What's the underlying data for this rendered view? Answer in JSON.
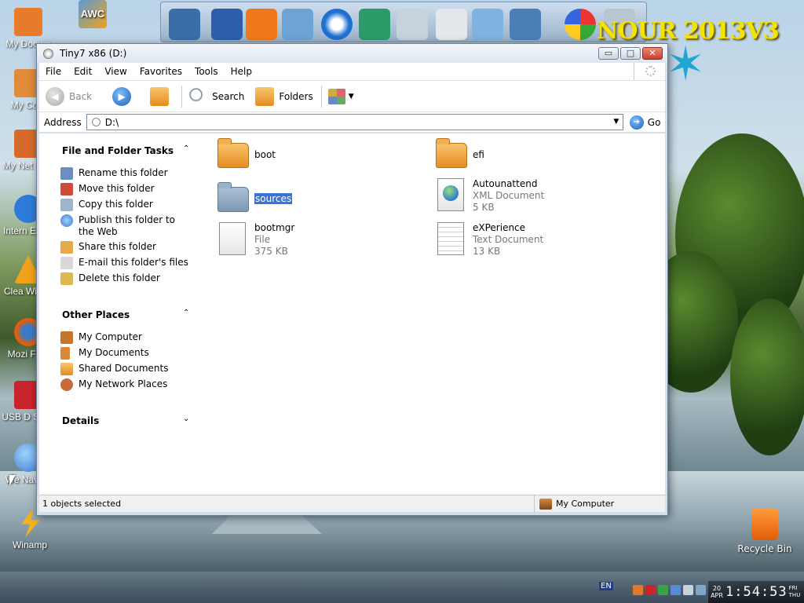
{
  "desktop": {
    "icons": [
      {
        "label": "My Docum",
        "color": "#e87a2b"
      },
      {
        "label": "My Com",
        "color": "#e08a3a"
      },
      {
        "label": "My Net Plac",
        "color": "#d66a2a"
      },
      {
        "label": "Intern Explo",
        "color": "#2d7bd8"
      },
      {
        "label": "Clea Windo",
        "color": "#f0a21a"
      },
      {
        "label": "Mozi Firef",
        "color": "#e35d0a"
      },
      {
        "label": "USB D Secu",
        "color": "#c8242d"
      },
      {
        "label": "We Naviga",
        "color": "#3a7ac8"
      },
      {
        "label": "Winamp",
        "color": "#f2b41b"
      }
    ],
    "top_icon_label": "AWC",
    "brand_text": "NOUR 2013V3",
    "recycle_bin": "Recycle Bin"
  },
  "window": {
    "title": "Tiny7 x86 (D:)",
    "controls": {
      "minimize": "▭",
      "maximize": "□",
      "close": "✕"
    },
    "menu": [
      "File",
      "Edit",
      "View",
      "Favorites",
      "Tools",
      "Help"
    ],
    "toolbar": {
      "back": "Back",
      "search": "Search",
      "folders": "Folders"
    },
    "address": {
      "label": "Address",
      "value": "D:\\",
      "go": "Go"
    },
    "tasks_panel": {
      "file_folder_tasks": {
        "title": "File and Folder Tasks",
        "items": [
          "Rename this folder",
          "Move this folder",
          "Copy this folder",
          "Publish this folder to the Web",
          "Share this folder",
          "E-mail this folder's files",
          "Delete this folder"
        ]
      },
      "other_places": {
        "title": "Other Places",
        "items": [
          "My Computer",
          "My Documents",
          "Shared Documents",
          "My Network Places"
        ]
      },
      "details": {
        "title": "Details"
      }
    },
    "files": [
      {
        "name": "boot",
        "kind": "folder"
      },
      {
        "name": "efi",
        "kind": "folder"
      },
      {
        "name": "sources",
        "kind": "folder-selected"
      },
      {
        "name": "Autounattend",
        "type": "XML Document",
        "size": "5 KB",
        "kind": "xml"
      },
      {
        "name": "bootmgr",
        "type": "File",
        "size": "375 KB",
        "kind": "file"
      },
      {
        "name": "eXPerience",
        "type": "Text Document",
        "size": "13 KB",
        "kind": "text"
      }
    ],
    "status": {
      "left": "1 objects selected",
      "right": "My Computer"
    }
  },
  "taskbar": {
    "lang": "EN",
    "date_day": "20",
    "date_month": "APR",
    "time": "1:54:53",
    "day_of_week_top": "FRI",
    "day_of_week_bottom": "THU"
  }
}
